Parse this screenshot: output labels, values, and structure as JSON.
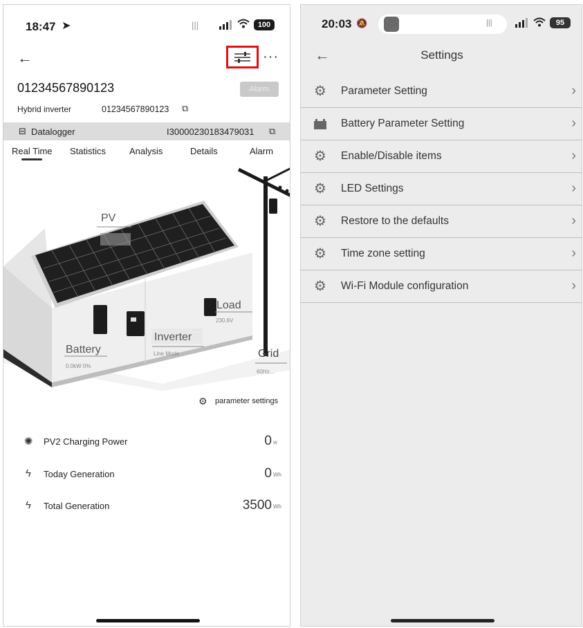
{
  "left": {
    "status": {
      "time": "18:47",
      "battery": "100"
    },
    "device": {
      "serial": "01234567890123",
      "alarm_button": "Alarm",
      "type_label": "Hybrid inverter",
      "type_serial": "01234567890123",
      "datalogger_label": "Datalogger",
      "datalogger_serial": "I30000230183479031"
    },
    "tabs": [
      "Real Time",
      "Statistics",
      "Analysis",
      "Details",
      "Alarm"
    ],
    "scene": {
      "pv_label": "PV",
      "load_label": "Load",
      "load_value": "230.6V",
      "battery_label": "Battery",
      "battery_value": "0.0kW  0%",
      "inverter_label": "Inverter",
      "inverter_mode": "Line Mode",
      "grid_label": "Grid",
      "grid_value": "60Hz..."
    },
    "param_settings": "parameter settings",
    "metrics": [
      {
        "icon": "sun-icon",
        "label": "PV2 Charging Power",
        "value": "0",
        "unit": "w"
      },
      {
        "icon": "bolt-icon",
        "label": "Today Generation",
        "value": "0",
        "unit": "Wh"
      },
      {
        "icon": "bolt-icon",
        "label": "Total Generation",
        "value": "3500",
        "unit": "Wh"
      }
    ]
  },
  "right": {
    "status": {
      "time": "20:03",
      "battery": "95"
    },
    "title": "Settings",
    "items": [
      {
        "icon": "gear-icon",
        "label": "Parameter Setting"
      },
      {
        "icon": "battery-icon",
        "label": "Battery Parameter Setting"
      },
      {
        "icon": "gear-icon",
        "label": "Enable/Disable items"
      },
      {
        "icon": "gear-icon",
        "label": "LED Settings"
      },
      {
        "icon": "gear-icon",
        "label": "Restore to the defaults"
      },
      {
        "icon": "gear-icon",
        "label": "Time zone setting"
      },
      {
        "icon": "gear-icon",
        "label": "Wi-Fi Module configuration"
      }
    ]
  },
  "colors": {
    "highlight_box": "#e01010",
    "settings_bg": "#ececec",
    "row_divider": "#bdbdbd"
  }
}
